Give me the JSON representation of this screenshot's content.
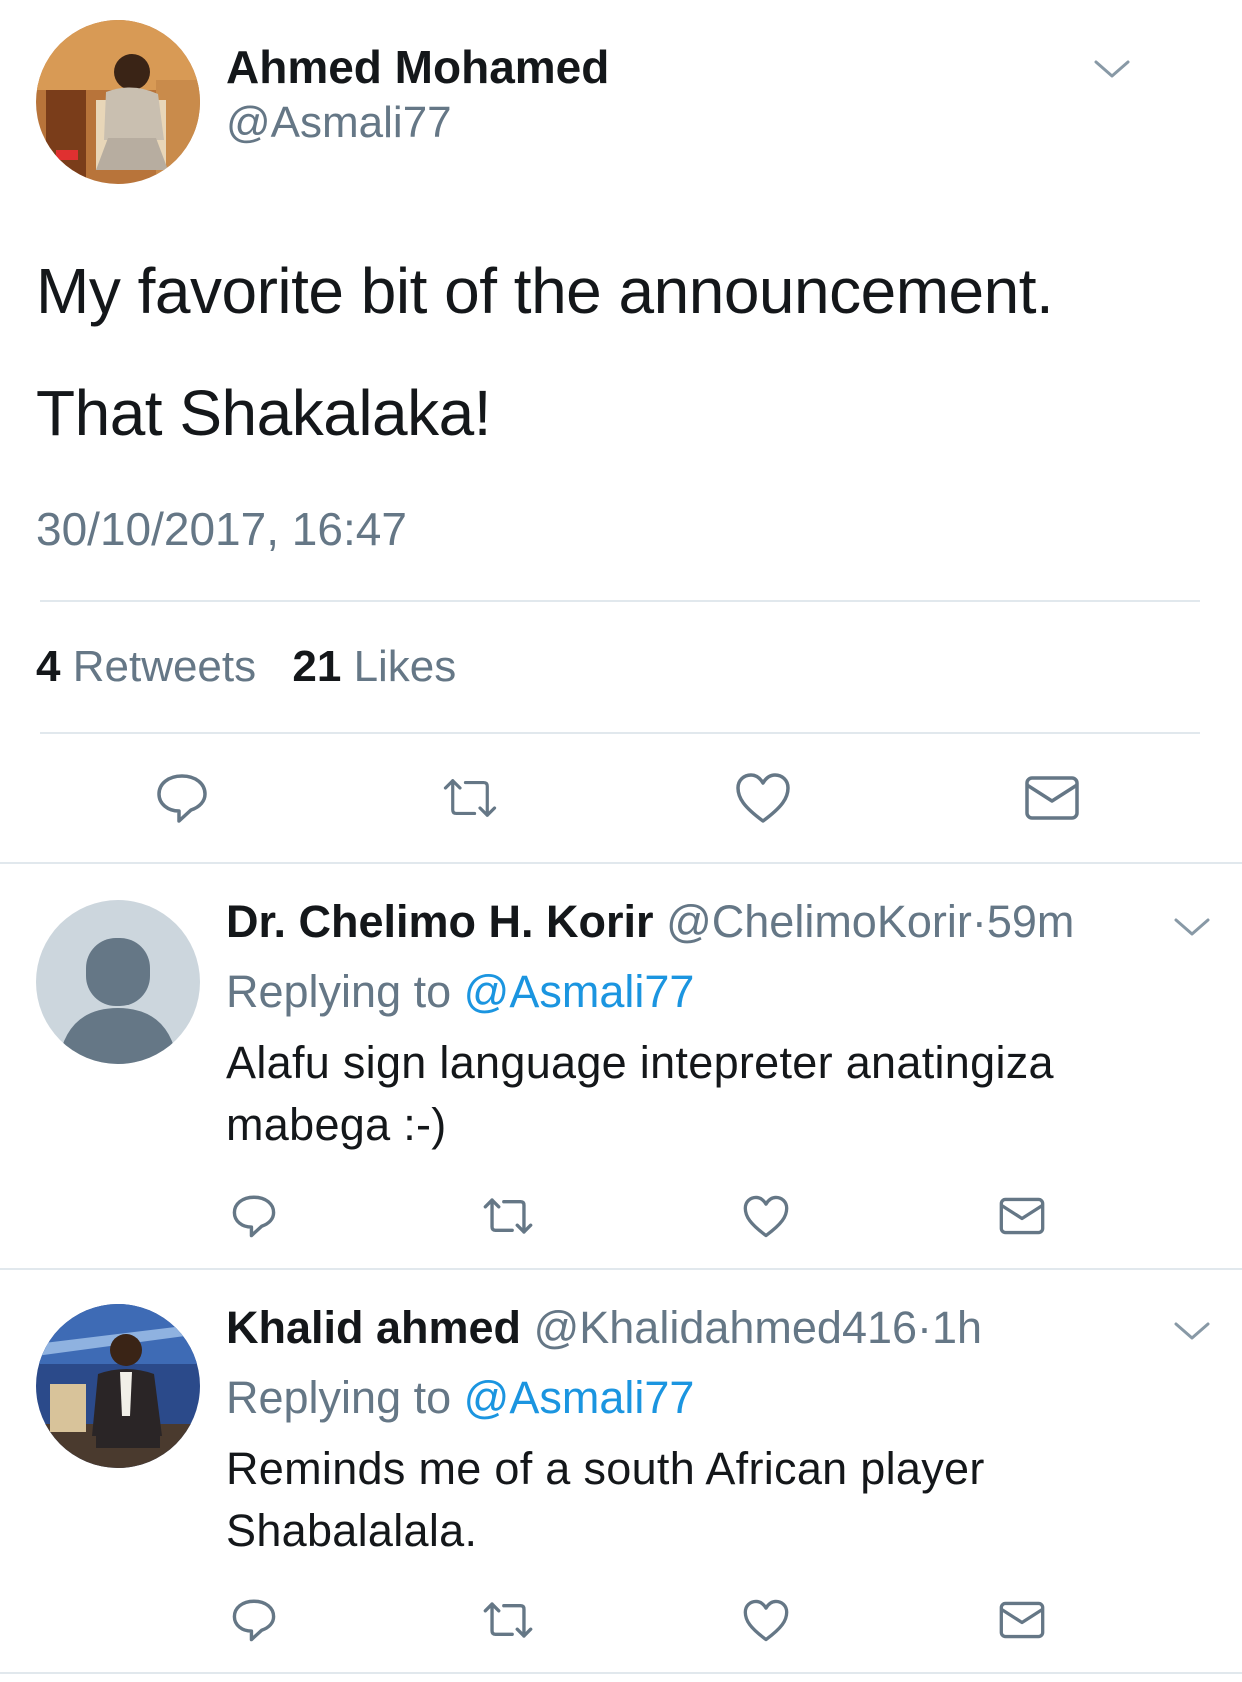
{
  "colors": {
    "primary_text": "#14171a",
    "secondary_text": "#657786",
    "link": "#1b95e0",
    "divider": "#e1e8ed",
    "icon": "#657786"
  },
  "main_tweet": {
    "author_name": "Ahmed Mohamed",
    "author_handle": "@Asmali77",
    "text_line1": "My favorite bit of the announcement.",
    "text_line2": "That Shakalaka!",
    "timestamp": "30/10/2017, 16:47",
    "retweets_count": "4",
    "retweets_label": "Retweets",
    "likes_count": "21",
    "likes_label": "Likes"
  },
  "replies": [
    {
      "author_name": "Dr. Chelimo H. Korir",
      "author_handle": "@ChelimoKorir",
      "separator": "·",
      "time": "59m",
      "replying_label": "Replying to",
      "replying_to": "@Asmali77",
      "text": "Alafu sign language intepreter anatingiza mabega :-)",
      "avatar": "default-avatar"
    },
    {
      "author_name": "Khalid ahmed",
      "author_handle": "@Khalidahmed416",
      "separator": "·",
      "time": "1h",
      "replying_label": "Replying to",
      "replying_to": "@Asmali77",
      "text": "Reminds me of a south African player Shabalalala.",
      "avatar": "photo"
    }
  ],
  "icons": {
    "reply": "reply-icon",
    "retweet": "retweet-icon",
    "like": "heart-icon",
    "message": "envelope-icon",
    "more": "chevron-down-icon"
  }
}
